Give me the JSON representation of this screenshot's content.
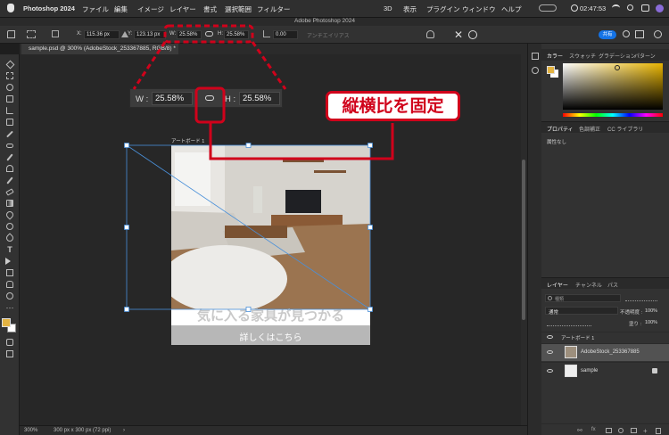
{
  "menubar": {
    "app": "Photoshop 2024",
    "items": [
      "ファイル",
      "編集",
      "イメージ",
      "レイヤー",
      "書式",
      "選択範囲",
      "フィルター",
      "3D",
      "表示",
      "プラグイン",
      "ウィンドウ",
      "ヘルプ"
    ],
    "clock": "02:47:53"
  },
  "window_title": "Adobe Photoshop 2024",
  "options": {
    "x_label": "X:",
    "x_value": "115.36 px",
    "y_label": "Y:",
    "y_value": "123.13 px",
    "w_label": "W:",
    "w_value": "25.58%",
    "h_label": "H:",
    "h_value": "25.58%",
    "angle_value": "0.00",
    "antialias": "アンチエイリアス",
    "share_label": "共有"
  },
  "doc_tab": "sample.psd @ 300% (AdobeStock_253367885, RGB/8) *",
  "zoom_info": {
    "w_label": "W :",
    "w_value": "25.58%",
    "h_label": "H :",
    "h_value": "25.58%"
  },
  "callout": "縦横比を固定",
  "artboard": {
    "name": "アートボード 1",
    "heading": "気に入る家具が見つかる",
    "button": "詳しくはこちら"
  },
  "status": {
    "zoom": "300%",
    "size": "300 px x 300 px (72 ppi)"
  },
  "color_panel": {
    "tabs": [
      "カラー",
      "スウォッチ",
      "グラデーション",
      "パターン"
    ]
  },
  "properties_panel": {
    "tabs": [
      "プロパティ",
      "色調補正",
      "CC ライブラリ"
    ],
    "content": "属性なし"
  },
  "layers_panel": {
    "tabs": [
      "レイヤー",
      "チャンネル",
      "パス"
    ],
    "search_placeholder": "種類",
    "blend_mode": "通常",
    "opacity_label": "不透明度 :",
    "opacity_value": "100%",
    "fill_label": "塗り :",
    "fill_value": "100%",
    "group": "アートボード 1",
    "layers": [
      {
        "name": "AdobeStock_253367885"
      },
      {
        "name": "sample"
      }
    ]
  },
  "colors": {
    "accent_red": "#d0021b",
    "share_blue": "#1473e6",
    "selection_blue": "#4a90d9"
  }
}
